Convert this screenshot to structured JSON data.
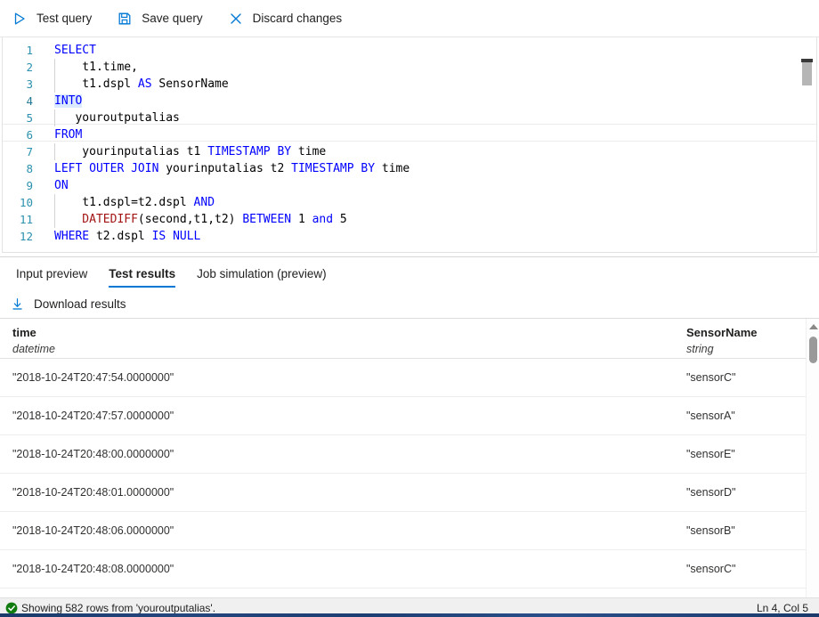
{
  "toolbar": {
    "buttons": [
      {
        "label": "Test query",
        "icon": "play-icon"
      },
      {
        "label": "Save query",
        "icon": "save-icon"
      },
      {
        "label": "Discard changes",
        "icon": "close-icon"
      }
    ]
  },
  "editor": {
    "language": "stream-analytics-sql",
    "cursor_line": 4,
    "lines": [
      {
        "n": "1",
        "tokens": [
          {
            "t": "SELECT",
            "c": "kw"
          }
        ]
      },
      {
        "n": "2",
        "tokens": [
          {
            "t": "    t1.time,",
            "c": "plain"
          }
        ]
      },
      {
        "n": "3",
        "tokens": [
          {
            "t": "    t1.dspl ",
            "c": "plain"
          },
          {
            "t": "AS",
            "c": "kw"
          },
          {
            "t": " SensorName",
            "c": "plain"
          }
        ]
      },
      {
        "n": "4",
        "tokens": [
          {
            "t": "INTO",
            "c": "kw sel"
          }
        ]
      },
      {
        "n": "5",
        "tokens": [
          {
            "t": "   youroutputalias",
            "c": "plain"
          }
        ]
      },
      {
        "n": "6",
        "tokens": [
          {
            "t": "FROM",
            "c": "kw"
          }
        ]
      },
      {
        "n": "7",
        "tokens": [
          {
            "t": "    yourinputalias t1 ",
            "c": "plain"
          },
          {
            "t": "TIMESTAMP BY",
            "c": "kw"
          },
          {
            "t": " time",
            "c": "plain"
          }
        ]
      },
      {
        "n": "8",
        "tokens": [
          {
            "t": "LEFT OUTER JOIN",
            "c": "kw"
          },
          {
            "t": " yourinputalias t2 ",
            "c": "plain"
          },
          {
            "t": "TIMESTAMP BY",
            "c": "kw"
          },
          {
            "t": " time",
            "c": "plain"
          }
        ]
      },
      {
        "n": "9",
        "tokens": [
          {
            "t": "ON",
            "c": "kw"
          }
        ]
      },
      {
        "n": "10",
        "tokens": [
          {
            "t": "    t1.dspl=t2.dspl ",
            "c": "plain"
          },
          {
            "t": "AND",
            "c": "kw"
          }
        ]
      },
      {
        "n": "11",
        "tokens": [
          {
            "t": "    DATEDIFF",
            "c": "fn"
          },
          {
            "t": "(second,t1,t2) ",
            "c": "plain"
          },
          {
            "t": "BETWEEN",
            "c": "kw"
          },
          {
            "t": " 1 ",
            "c": "plain"
          },
          {
            "t": "and",
            "c": "kw"
          },
          {
            "t": " 5",
            "c": "plain"
          }
        ]
      },
      {
        "n": "12",
        "tokens": [
          {
            "t": "WHERE",
            "c": "kw"
          },
          {
            "t": " t2.dspl ",
            "c": "plain"
          },
          {
            "t": "IS NULL",
            "c": "kw"
          }
        ]
      }
    ]
  },
  "tabs": [
    {
      "label": "Input preview",
      "active": false
    },
    {
      "label": "Test results",
      "active": true
    },
    {
      "label": "Job simulation (preview)",
      "active": false
    }
  ],
  "download": {
    "label": "Download results",
    "icon": "download-icon"
  },
  "table": {
    "columns": [
      {
        "name": "time",
        "type": "datetime"
      },
      {
        "name": "SensorName",
        "type": "string"
      }
    ],
    "rows": [
      [
        "\"2018-10-24T20:47:54.0000000\"",
        "\"sensorC\""
      ],
      [
        "\"2018-10-24T20:47:57.0000000\"",
        "\"sensorA\""
      ],
      [
        "\"2018-10-24T20:48:00.0000000\"",
        "\"sensorE\""
      ],
      [
        "\"2018-10-24T20:48:01.0000000\"",
        "\"sensorD\""
      ],
      [
        "\"2018-10-24T20:48:06.0000000\"",
        "\"sensorB\""
      ],
      [
        "\"2018-10-24T20:48:08.0000000\"",
        "\"sensorC\""
      ]
    ]
  },
  "status": {
    "icon": "success-check-icon",
    "message": "Showing 582 rows from 'youroutputalias'.",
    "cursor_position": "Ln 4, Col 5"
  },
  "colors": {
    "accent": "#0078d4",
    "keyword": "#0000ff",
    "function": "#a31515",
    "line_number": "#2b91af",
    "success": "#107c10"
  }
}
